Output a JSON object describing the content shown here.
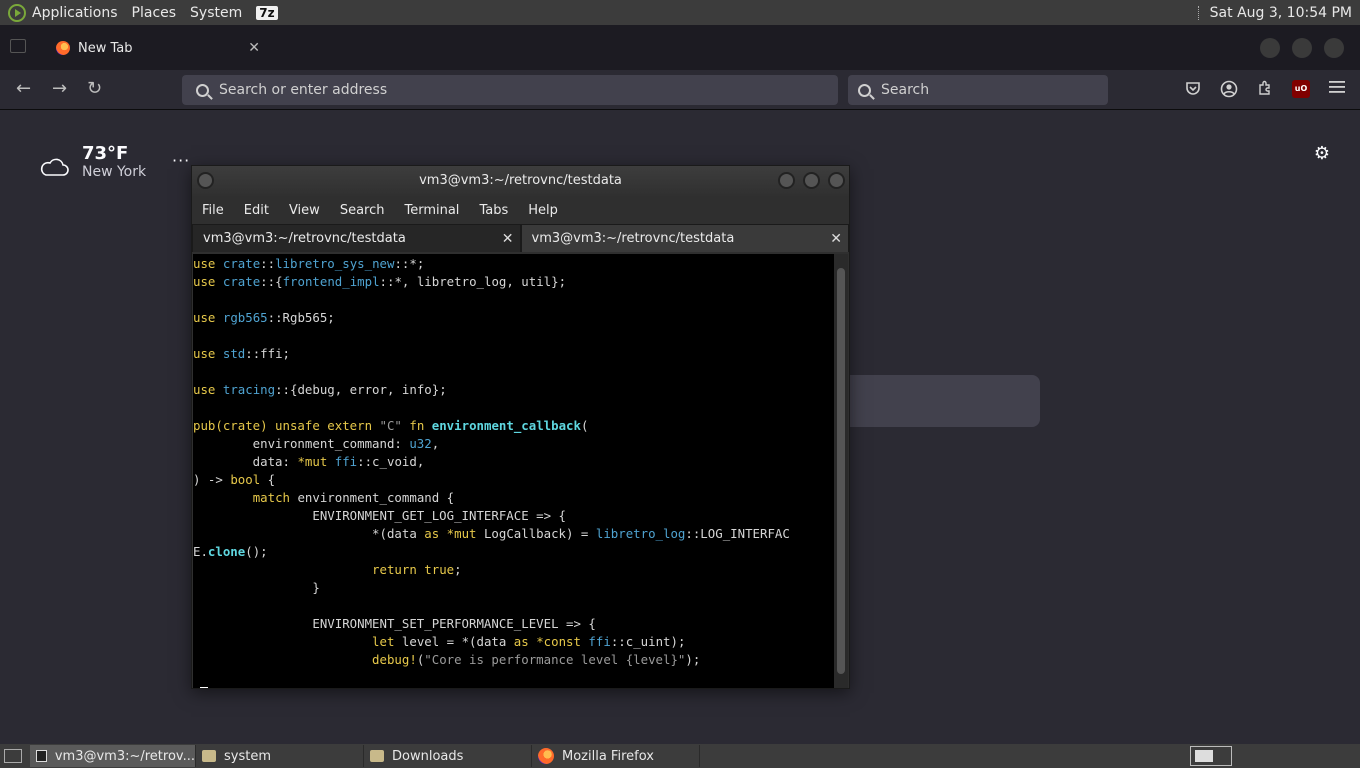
{
  "topbar": {
    "menus": [
      "Applications",
      "Places",
      "System"
    ],
    "zip_badge": "7z",
    "clock": "Sat Aug  3, 10:54 PM"
  },
  "browser": {
    "tab_title": "New Tab",
    "tab_close": "✕",
    "url_placeholder": "Search or enter address",
    "search_placeholder": "Search"
  },
  "newtab": {
    "weather_temp": "73°F",
    "weather_city": "New York",
    "weather_menu": "···"
  },
  "terminal": {
    "title": "vm3@vm3:~/retrovnc/testdata",
    "menu": [
      "File",
      "Edit",
      "View",
      "Search",
      "Terminal",
      "Tabs",
      "Help"
    ],
    "tabs": [
      "vm3@vm3:~/retrovnc/testdata",
      "vm3@vm3:~/retrovnc/testdata"
    ],
    "prompt": "/"
  },
  "taskbar": {
    "items": [
      "vm3@vm3:~/retrov...",
      "system",
      "Downloads",
      "Mozilla Firefox"
    ]
  },
  "colors": {
    "keyword": "#e6c84a",
    "type": "#4fa3d1",
    "function": "#5fd7e0",
    "string": "#9a9a9a"
  }
}
